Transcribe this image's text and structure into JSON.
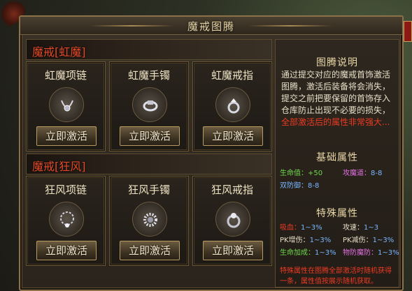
{
  "window": {
    "title": "魔戒图腾"
  },
  "sections": [
    {
      "title": "魔戒[虹魔]",
      "items": [
        {
          "name": "虹魔项链",
          "icon": "necklace-icon",
          "button": "立即激活"
        },
        {
          "name": "虹魔手镯",
          "icon": "bracelet-icon",
          "button": "立即激活"
        },
        {
          "name": "虹魔戒指",
          "icon": "ring-icon",
          "button": "立即激活"
        }
      ]
    },
    {
      "title": "魔戒[狂风]",
      "items": [
        {
          "name": "狂风项链",
          "icon": "necklace-icon",
          "button": "立即激活"
        },
        {
          "name": "狂风手镯",
          "icon": "bracelet-icon",
          "button": "立即激活"
        },
        {
          "name": "狂风戒指",
          "icon": "ring-icon",
          "button": "立即激活"
        }
      ]
    }
  ],
  "info": {
    "heading": "图腾说明",
    "desc_normal": "通过提交对应的魔戒首饰激活图腾，激活后装备将会消失，提交之前把要保留的首饰存入仓库防止出现不必要的损失，",
    "desc_red": "全部激活后的属性非常强大...",
    "base_heading": "基础属性",
    "base_stats": [
      {
        "label": "生命值：",
        "value": "+50"
      },
      {
        "label": "攻魔道：",
        "value": "8-8"
      },
      {
        "label": "双防御：",
        "value": "8-8"
      }
    ],
    "special_heading": "特殊属性",
    "special_stats": [
      {
        "label": "吸血：",
        "value": "1~3%"
      },
      {
        "label": "攻速：",
        "value": "1~3"
      },
      {
        "label": "PK增伤：",
        "value": "1~3%"
      },
      {
        "label": "PK减伤：",
        "value": "1~3%"
      },
      {
        "label": "生命加成：",
        "value": "1~3%"
      },
      {
        "label": "物防魔防：",
        "value": "1~3%"
      }
    ],
    "footnote": "特殊属性在图腾全部激活时随机获得一条，属性值按展示随机获取。"
  },
  "colors": {
    "accent_red": "#ee3a22",
    "stat_green": "#6fd84a",
    "stat_blue": "#79b6ff",
    "stat_pink": "#e070e0",
    "gold": "#e9d7a8"
  }
}
